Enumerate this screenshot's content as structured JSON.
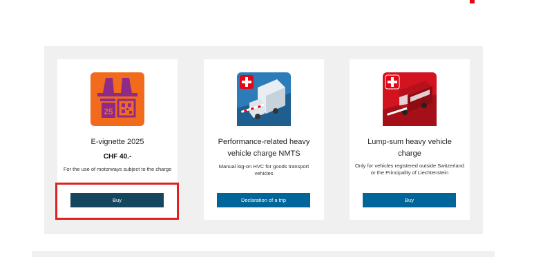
{
  "cards": [
    {
      "title": "E-vignette 2025",
      "price": "CHF 40.-",
      "description": "For the use of motorways subject to the charge",
      "button_label": "Buy",
      "icon": "e-vignette-icon",
      "icon_badge": "25"
    },
    {
      "title": "Performance-related heavy vehicle charge NMTS",
      "description": "Manual log-on HVC for goods transport vehicles",
      "button_label": "Declaration of a trip",
      "icon": "truck-icon"
    },
    {
      "title": "Lump-sum heavy vehicle charge",
      "description": "Only for vehicles registered outside Switzerland or the Principality of Liechtenstein",
      "button_label": "Buy",
      "icon": "bus-icon"
    }
  ],
  "colors": {
    "vignette_orange": "#f26a1b",
    "vignette_purple": "#8e2a87",
    "button_dark": "#16465e",
    "button_blue": "#006699",
    "swiss_red": "#e30613",
    "highlight_red": "#e02020"
  }
}
